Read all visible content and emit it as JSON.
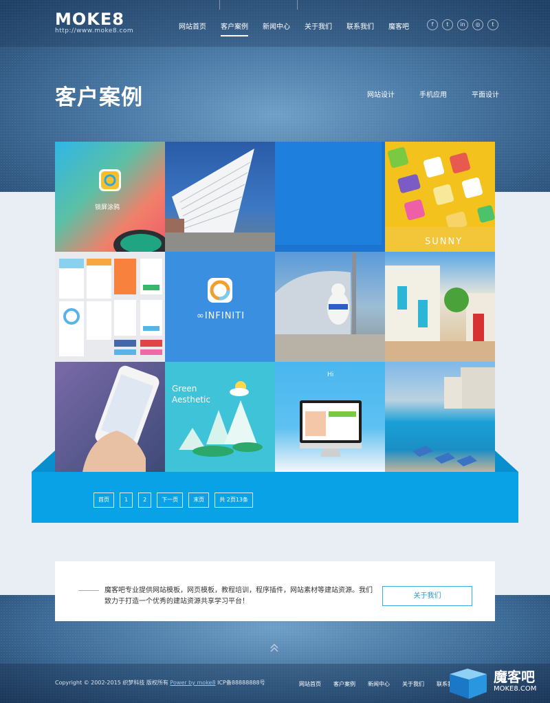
{
  "brand": {
    "logo_text": "MOKE8",
    "logo_url": "http://www.moke8.com"
  },
  "nav": {
    "items": [
      {
        "label": "网站首页",
        "active": false
      },
      {
        "label": "客户案例",
        "active": true
      },
      {
        "label": "新闻中心",
        "active": false
      },
      {
        "label": "关于我们",
        "active": false
      },
      {
        "label": "联系我们",
        "active": false
      },
      {
        "label": "魔客吧",
        "active": false
      }
    ]
  },
  "social": [
    "f",
    "t",
    "in",
    "◎",
    "t"
  ],
  "page": {
    "title": "客户案例",
    "categories": [
      "网站设计",
      "手机应用",
      "平面设计"
    ]
  },
  "tiles": {
    "t1_caption": "锁屏涂鸦",
    "t4_caption": "SUNNY",
    "t6_caption": "∞INFINITI",
    "t10_caption_1": "Green",
    "t10_caption_2": "Aesthetic",
    "t11_caption": "Hi"
  },
  "pagination": [
    "首页",
    "1",
    "2",
    "下一页",
    "末页",
    "共 2页13条"
  ],
  "about": {
    "text": "魔客吧专业提供网站模板，网页模板，教程培训，程序插件，网站素材等建站资源。我们致力于打造一个优秀的建站资源共享学习平台！",
    "button": "关于我们"
  },
  "footer": {
    "copyright": "Copyright © 2002-2015 织梦科技 版权所有",
    "power": "Power by moke8",
    "icp": "ICP备88888888号",
    "nav": [
      "网站首页",
      "客户案例",
      "新闻中心",
      "关于我们",
      "联系我们"
    ]
  },
  "watermark": {
    "text": "魔客吧",
    "sub": "MOKE8.COM"
  }
}
